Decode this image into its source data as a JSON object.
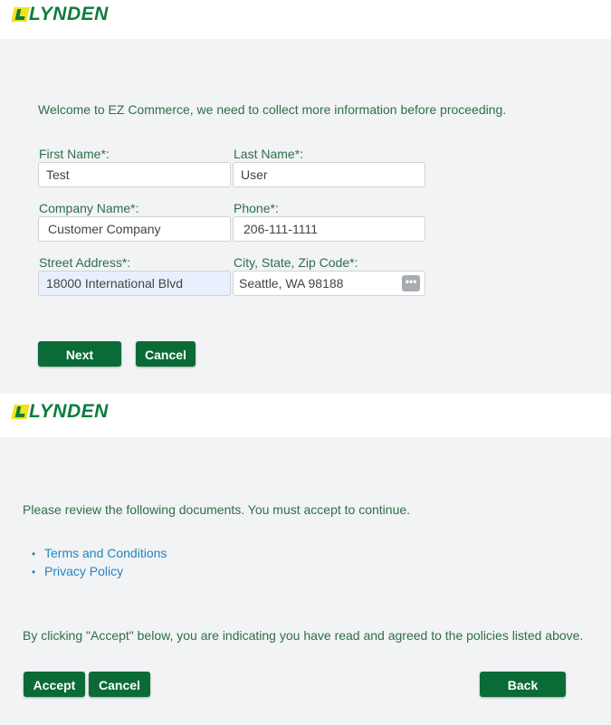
{
  "brand": {
    "logo_text": "LYNDEN"
  },
  "form_step": {
    "intro": "Welcome to EZ Commerce, we need to collect more information before proceeding.",
    "fields": {
      "first_name": {
        "label": "First Name*:",
        "value": "Test"
      },
      "last_name": {
        "label": "Last Name*:",
        "value": "User"
      },
      "company_name": {
        "label": "Company Name*:",
        "value": "Customer Company"
      },
      "phone": {
        "label": "Phone*:",
        "value": "206-111-1111"
      },
      "street_address": {
        "label": "Street Address*:",
        "value": "18000 International Blvd"
      },
      "city_state_zip": {
        "label": "City, State, Zip Code*:",
        "value": "Seattle, WA 98188"
      }
    },
    "next_label": "Next",
    "cancel_label": "Cancel"
  },
  "documents_step": {
    "intro": "Please review the following documents. You must accept to continue.",
    "documents": [
      "Terms and Conditions",
      "Privacy Policy"
    ],
    "agreement": "By clicking \"Accept\" below, you are indicating you have read and agreed to the policies listed above.",
    "accept_label": "Accept",
    "cancel_label": "Cancel",
    "back_label": "Back"
  },
  "colors": {
    "brand_green": "#0b7d3e",
    "button_green": "#0b6b37",
    "logo_yellow": "#f2e31a",
    "text_green": "#2f6e4a",
    "link_blue": "#1f86c3",
    "panel_bg": "#f2f3f4"
  }
}
